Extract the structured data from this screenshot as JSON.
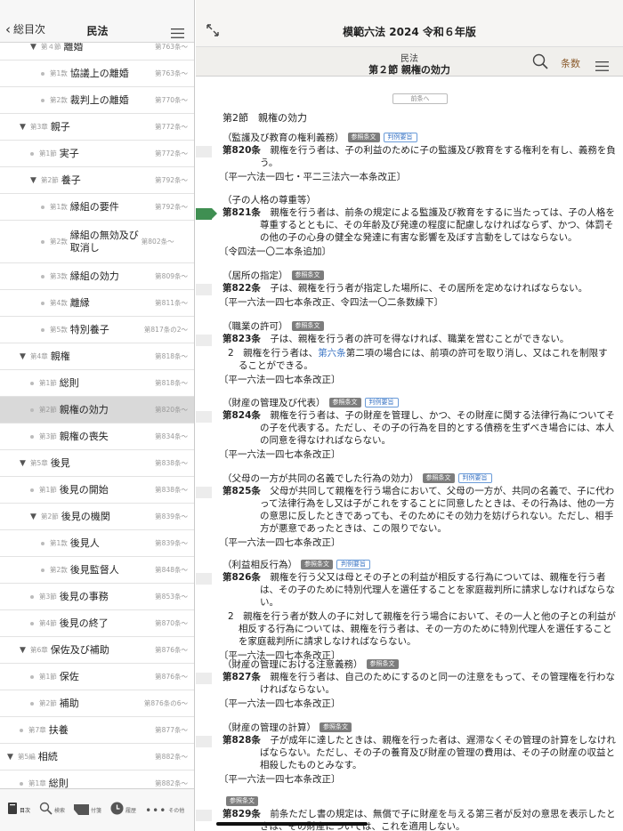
{
  "left": {
    "back_label": "総目次",
    "title": "民法",
    "toc": [
      {
        "type": "article",
        "num": "第４節",
        "label": "離婚",
        "ref": "第763条〜",
        "indent": 2,
        "tri": true
      },
      {
        "type": "article",
        "num": "第1款",
        "label": "協議上の離婚",
        "ref": "第763条〜",
        "indent": 3
      },
      {
        "type": "article",
        "num": "第2款",
        "label": "裁判上の離婚",
        "ref": "第770条〜",
        "indent": 3
      },
      {
        "type": "chapter",
        "num": "第3章",
        "label": "親子",
        "ref": "第772条〜",
        "indent": 1,
        "tri": true
      },
      {
        "type": "article",
        "num": "第1節",
        "label": "実子",
        "ref": "第772条〜",
        "indent": 2
      },
      {
        "type": "article",
        "num": "第2節",
        "label": "養子",
        "ref": "第792条〜",
        "indent": 2,
        "tri": true
      },
      {
        "type": "article",
        "num": "第1款",
        "label": "縁組の要件",
        "ref": "第792条〜",
        "indent": 3
      },
      {
        "type": "article",
        "num": "第2款",
        "label": "縁組の無効及び取消し",
        "ref": "第802条〜",
        "indent": 3,
        "tall": true
      },
      {
        "type": "article",
        "num": "第3款",
        "label": "縁組の効力",
        "ref": "第809条〜",
        "indent": 3
      },
      {
        "type": "article",
        "num": "第4款",
        "label": "離縁",
        "ref": "第811条〜",
        "indent": 3
      },
      {
        "type": "article",
        "num": "第5款",
        "label": "特別養子",
        "ref": "第817条の2〜",
        "indent": 3
      },
      {
        "type": "chapter",
        "num": "第4章",
        "label": "親権",
        "ref": "第818条〜",
        "indent": 1,
        "tri": true
      },
      {
        "type": "article",
        "num": "第1節",
        "label": "総則",
        "ref": "第818条〜",
        "indent": 2
      },
      {
        "type": "article",
        "num": "第2節",
        "label": "親権の効力",
        "ref": "第820条〜",
        "indent": 2,
        "selected": true
      },
      {
        "type": "article",
        "num": "第3節",
        "label": "親権の喪失",
        "ref": "第834条〜",
        "indent": 2
      },
      {
        "type": "chapter",
        "num": "第5章",
        "label": "後見",
        "ref": "第838条〜",
        "indent": 1,
        "tri": true
      },
      {
        "type": "article",
        "num": "第1節",
        "label": "後見の開始",
        "ref": "第838条〜",
        "indent": 2
      },
      {
        "type": "article",
        "num": "第2節",
        "label": "後見の機関",
        "ref": "第839条〜",
        "indent": 2,
        "tri": true
      },
      {
        "type": "article",
        "num": "第1款",
        "label": "後見人",
        "ref": "第839条〜",
        "indent": 3
      },
      {
        "type": "article",
        "num": "第2款",
        "label": "後見監督人",
        "ref": "第848条〜",
        "indent": 3
      },
      {
        "type": "article",
        "num": "第3節",
        "label": "後見の事務",
        "ref": "第853条〜",
        "indent": 2
      },
      {
        "type": "article",
        "num": "第4節",
        "label": "後見の終了",
        "ref": "第870条〜",
        "indent": 2
      },
      {
        "type": "chapter",
        "num": "第6章",
        "label": "保佐及び補助",
        "ref": "第876条〜",
        "indent": 1,
        "tri": true
      },
      {
        "type": "article",
        "num": "第1節",
        "label": "保佐",
        "ref": "第876条〜",
        "indent": 2
      },
      {
        "type": "article",
        "num": "第2節",
        "label": "補助",
        "ref": "第876条の6〜",
        "indent": 2
      },
      {
        "type": "chapter",
        "num": "第7章",
        "label": "扶養",
        "ref": "第877条〜",
        "indent": 1
      },
      {
        "type": "part",
        "num": "第5編",
        "label": "相続",
        "ref": "第882条〜",
        "indent": 0,
        "tri": true
      },
      {
        "type": "chapter",
        "num": "第1章",
        "label": "総則",
        "ref": "第882条〜",
        "indent": 1
      }
    ],
    "footer_tabs": [
      {
        "icon": "book-icon",
        "label": "目次",
        "active": true
      },
      {
        "icon": "search-icon",
        "label": "検索"
      },
      {
        "icon": "tag-icon",
        "label": "付箋"
      },
      {
        "icon": "history-icon",
        "label": "履歴"
      },
      {
        "icon": "more-icon",
        "label": "その他"
      }
    ]
  },
  "right": {
    "app_title": "模範六法 2024 令和６年版",
    "sub_law": "民法",
    "sub_section": "第２節 親権の効力",
    "jobun_label": "条数",
    "prev_label": "前条へ",
    "section_heading": "第2節　親権の効力",
    "articles": [
      {
        "caption": "（監護及び教育の権利義務）",
        "badges": [
          "参照条文",
          "判例要旨"
        ],
        "num": "第820条",
        "text": "親権を行う者は、子の利益のために子の監護及び教育をする権利を有し、義務を負う。",
        "history": "〔平一六法一四七・平二三法六一本条改正〕"
      },
      {
        "caption": "（子の人格の尊重等）",
        "badges": [],
        "num": "第821条",
        "text": "親権を行う者は、前条の規定による監護及び教育をするに当たっては、子の人格を尊重するとともに、その年齢及び発達の程度に配慮しなければならず、かつ、体罰その他の子の心身の健全な発達に有害な影響を及ぼす言動をしてはならない。",
        "history": "〔令四法一〇二本条追加〕",
        "marker": "green"
      },
      {
        "caption": "（居所の指定）",
        "badges": [
          "参照条文"
        ],
        "num": "第822条",
        "text": "子は、親権を行う者が指定した場所に、その居所を定めなければならない。",
        "history": "〔平一六法一四七本条改正、令四法一〇二条数繰下〕"
      },
      {
        "caption": "（職業の許可）",
        "badges": [
          "参照条文"
        ],
        "num": "第823条",
        "text": "子は、親権を行う者の許可を得なければ、職業を営むことができない。",
        "para2_pre": "2　親権を行う者は、",
        "para2_link": "第六条",
        "para2_post": "第二項の場合には、前項の許可を取り消し、又はこれを制限することができる。",
        "history": "〔平一六法一四七本条改正〕"
      },
      {
        "caption": "（財産の管理及び代表）",
        "badges": [
          "参照条文",
          "判例要旨"
        ],
        "num": "第824条",
        "text": "親権を行う者は、子の財産を管理し、かつ、その財産に関する法律行為についてその子を代表する。ただし、その子の行為を目的とする債務を生ずべき場合には、本人の同意を得なければならない。",
        "history": "〔平一六法一四七本条改正〕"
      },
      {
        "caption": "（父母の一方が共同の名義でした行為の効力）",
        "badges": [
          "参照条文",
          "判例要旨"
        ],
        "num": "第825条",
        "text": "父母が共同して親権を行う場合において、父母の一方が、共同の名義で、子に代わって法律行為をし又は子がこれをすることに同意したときは、その行為は、他の一方の意思に反したときであっても、そのためにその効力を妨げられない。ただし、相手方が悪意であったときは、この限りでない。",
        "history": "〔平一六法一四七本条改正〕"
      },
      {
        "caption": "（利益相反行為）",
        "badges": [
          "参照条文",
          "判例要旨"
        ],
        "num": "第826条",
        "text": "親権を行う父又は母とその子との利益が相反する行為については、親権を行う者は、その子のために特別代理人を選任することを家庭裁判所に請求しなければならない。",
        "para2_pre": "2　親権を行う者が数人の子に対して親権を行う場合において、その一人と他の子との利益が相反する行為については、親権を行う者は、その一方のために特別代理人を選任することを家庭裁判所に請求しなければならない。",
        "history": "〔平一六法一四七本条改正〕"
      },
      {
        "caption": "（財産の管理における注意義務）",
        "badges": [
          "参照条文"
        ],
        "num": "第827条",
        "text": "親権を行う者は、自己のためにするのと同一の注意をもって、その管理権を行わなければならない。",
        "history": "〔平一六法一四七本条改正〕"
      },
      {
        "caption": "（財産の管理の計算）",
        "badges": [
          "参照条文"
        ],
        "num": "第828条",
        "text": "子が成年に達したときは、親権を行った者は、遅滞なくその管理の計算をしなければならない。ただし、その子の養育及び財産の管理の費用は、その子の財産の収益と相殺したものとみなす。",
        "history": "〔平一六法一四七本条改正〕"
      },
      {
        "caption": "",
        "badges": [
          "参照条文"
        ],
        "num": "第829条",
        "text": "前条ただし書の規定は、無償で子に財産を与える第三者が反対の意思を表示したときは、その財産については、これを適用しない。",
        "history": ""
      }
    ]
  }
}
